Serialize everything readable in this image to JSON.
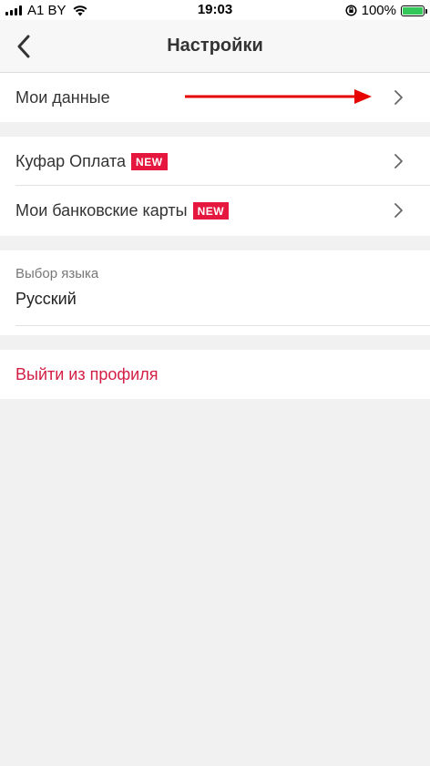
{
  "status_bar": {
    "carrier": "A1 BY",
    "time": "19:03",
    "battery": "100%"
  },
  "nav": {
    "title": "Настройки"
  },
  "sections": {
    "my_data": {
      "label": "Мои данные"
    },
    "kufar_pay": {
      "label": "Куфар Оплата",
      "badge": "NEW"
    },
    "bank_cards": {
      "label": "Мои банковские карты",
      "badge": "NEW"
    },
    "language": {
      "caption": "Выбор языка",
      "value": "Русский"
    },
    "logout": {
      "label": "Выйти из профиля"
    }
  },
  "colors": {
    "accent": "#d21e45",
    "badge": "#e5173f",
    "annotation_arrow": "#e60000"
  },
  "icons": [
    "back-chevron-icon",
    "chevron-right-icon",
    "wifi-icon",
    "battery-icon",
    "signal-icon",
    "orientation-lock-icon",
    "annotation-arrow-icon"
  ]
}
